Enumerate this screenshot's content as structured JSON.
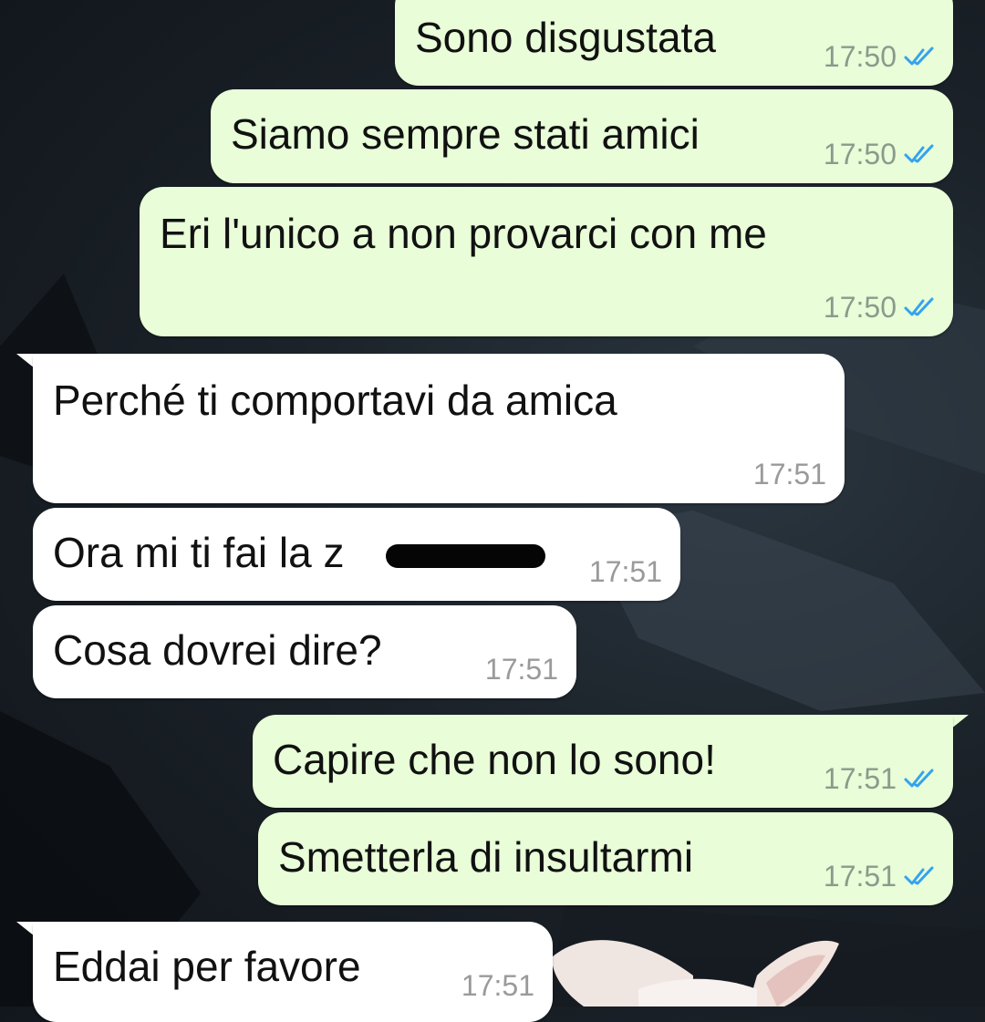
{
  "colors": {
    "outgoing_bubble": "#e8fdd8",
    "incoming_bubble": "#ffffff",
    "read_ticks": "#34a3ee",
    "background": "#1b2229"
  },
  "messages": [
    {
      "direction": "outgoing",
      "text": "Sono disgustata",
      "time": "17:50",
      "status": "read"
    },
    {
      "direction": "outgoing",
      "text": "Siamo sempre stati amici",
      "time": "17:50",
      "status": "read"
    },
    {
      "direction": "outgoing",
      "text": "Eri l'unico a non provarci con me",
      "time": "17:50",
      "status": "read"
    },
    {
      "direction": "incoming",
      "text": "Perché ti comportavi da amica",
      "time": "17:51"
    },
    {
      "direction": "incoming",
      "text": "Ora mi ti fai la z",
      "time": "17:51",
      "redacted": true
    },
    {
      "direction": "incoming",
      "text": "Cosa dovrei dire?",
      "time": "17:51"
    },
    {
      "direction": "outgoing",
      "text": "Capire che non lo sono!",
      "time": "17:51",
      "status": "read"
    },
    {
      "direction": "outgoing",
      "text": "Smetterla di insultarmi",
      "time": "17:51",
      "status": "read"
    },
    {
      "direction": "incoming",
      "text": "Eddai per favore",
      "time": "17:51"
    }
  ]
}
